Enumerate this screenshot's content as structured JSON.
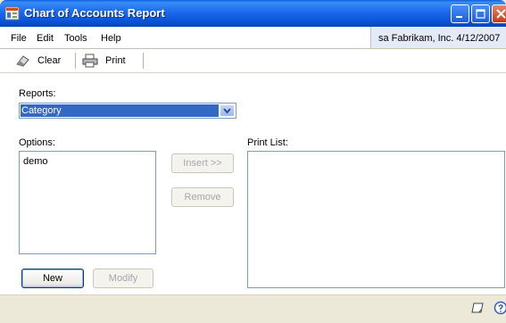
{
  "window": {
    "title": "Chart of Accounts Report"
  },
  "menu": {
    "file": "File",
    "edit": "Edit",
    "tools": "Tools",
    "help": "Help"
  },
  "status": {
    "user_company_date": "sa  Fabrikam, Inc.  4/12/2007"
  },
  "toolbar": {
    "clear_label": "Clear",
    "print_label": "Print"
  },
  "reports": {
    "label": "Reports:",
    "selected": "Category"
  },
  "options": {
    "label": "Options:",
    "items": [
      "demo"
    ]
  },
  "print_list": {
    "label": "Print List:"
  },
  "buttons": {
    "insert": "Insert >>",
    "remove": "Remove",
    "new": "New",
    "modify": "Modify"
  },
  "icons": [
    "app-icon",
    "minimize-icon",
    "maximize-icon",
    "close-icon",
    "eraser-icon",
    "printer-icon",
    "dropdown-arrow-icon",
    "note-icon",
    "help-icon"
  ]
}
